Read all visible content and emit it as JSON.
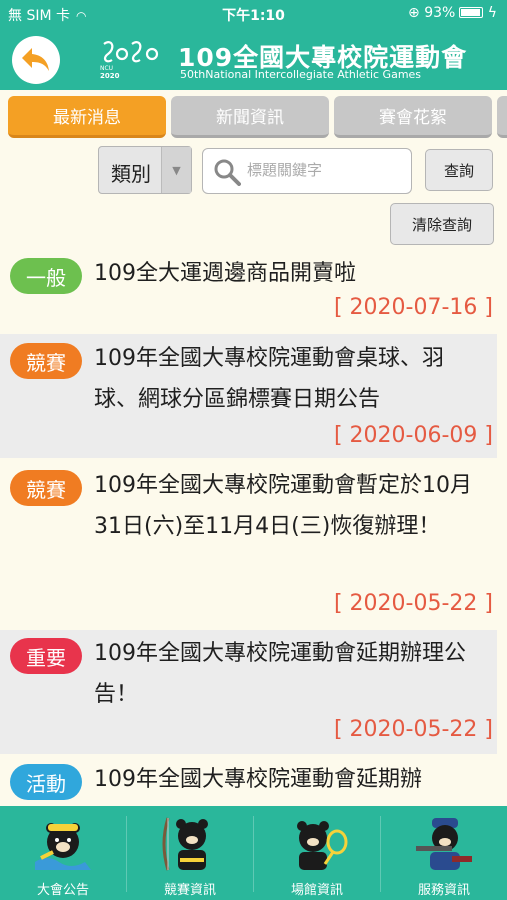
{
  "status": {
    "carrier": "無 SIM 卡",
    "time": "下午1:10",
    "battery": "93%"
  },
  "header": {
    "title": "109全國大專校院運動會",
    "subtitle": "50thNational Intercollegiate Athletic Games",
    "logo_year": "2020",
    "logo_small": "NCU"
  },
  "tabs": [
    {
      "label": "最新消息",
      "active": true
    },
    {
      "label": "新聞資訊",
      "active": false
    },
    {
      "label": "賽會花絮",
      "active": false
    }
  ],
  "search": {
    "category": "類別",
    "placeholder": "標題關鍵字",
    "value": "",
    "query_label": "查詢",
    "clear_label": "清除查詢"
  },
  "news": [
    {
      "tag": "一般",
      "tag_color": "#6dc04f",
      "title": "109全大運週邊商品開賣啦",
      "date": "[ 2020-07-16 ]"
    },
    {
      "tag": "競賽",
      "tag_color": "#f07c22",
      "title": "109年全國大專校院運動會桌球、羽球、網球分區錦標賽日期公告",
      "date": "[ 2020-06-09 ]"
    },
    {
      "tag": "競賽",
      "tag_color": "#f07c22",
      "title": "109年全國大專校院運動會暫定於10月31日(六)至11月4日(三)恢復辦理！",
      "date": "[ 2020-05-22 ]"
    },
    {
      "tag": "重要",
      "tag_color": "#e8344c",
      "title": "109年全國大專校院運動會延期辦理公告！",
      "date": "[ 2020-05-22 ]"
    },
    {
      "tag": "活動",
      "tag_color": "#30a7dc",
      "title": "109年全國大專校院運動會延期辦",
      "date": ""
    }
  ],
  "bottom_nav": [
    {
      "label": "大會公告",
      "icon": "bear-swimmer-icon"
    },
    {
      "label": "競賽資訊",
      "icon": "bear-archer-icon"
    },
    {
      "label": "場館資訊",
      "icon": "bear-tennis-icon"
    },
    {
      "label": "服務資訊",
      "icon": "bear-shooter-icon"
    }
  ],
  "colors": {
    "brand": "#2ab79b",
    "active_tab": "#f4a024",
    "date": "#e55a42"
  }
}
